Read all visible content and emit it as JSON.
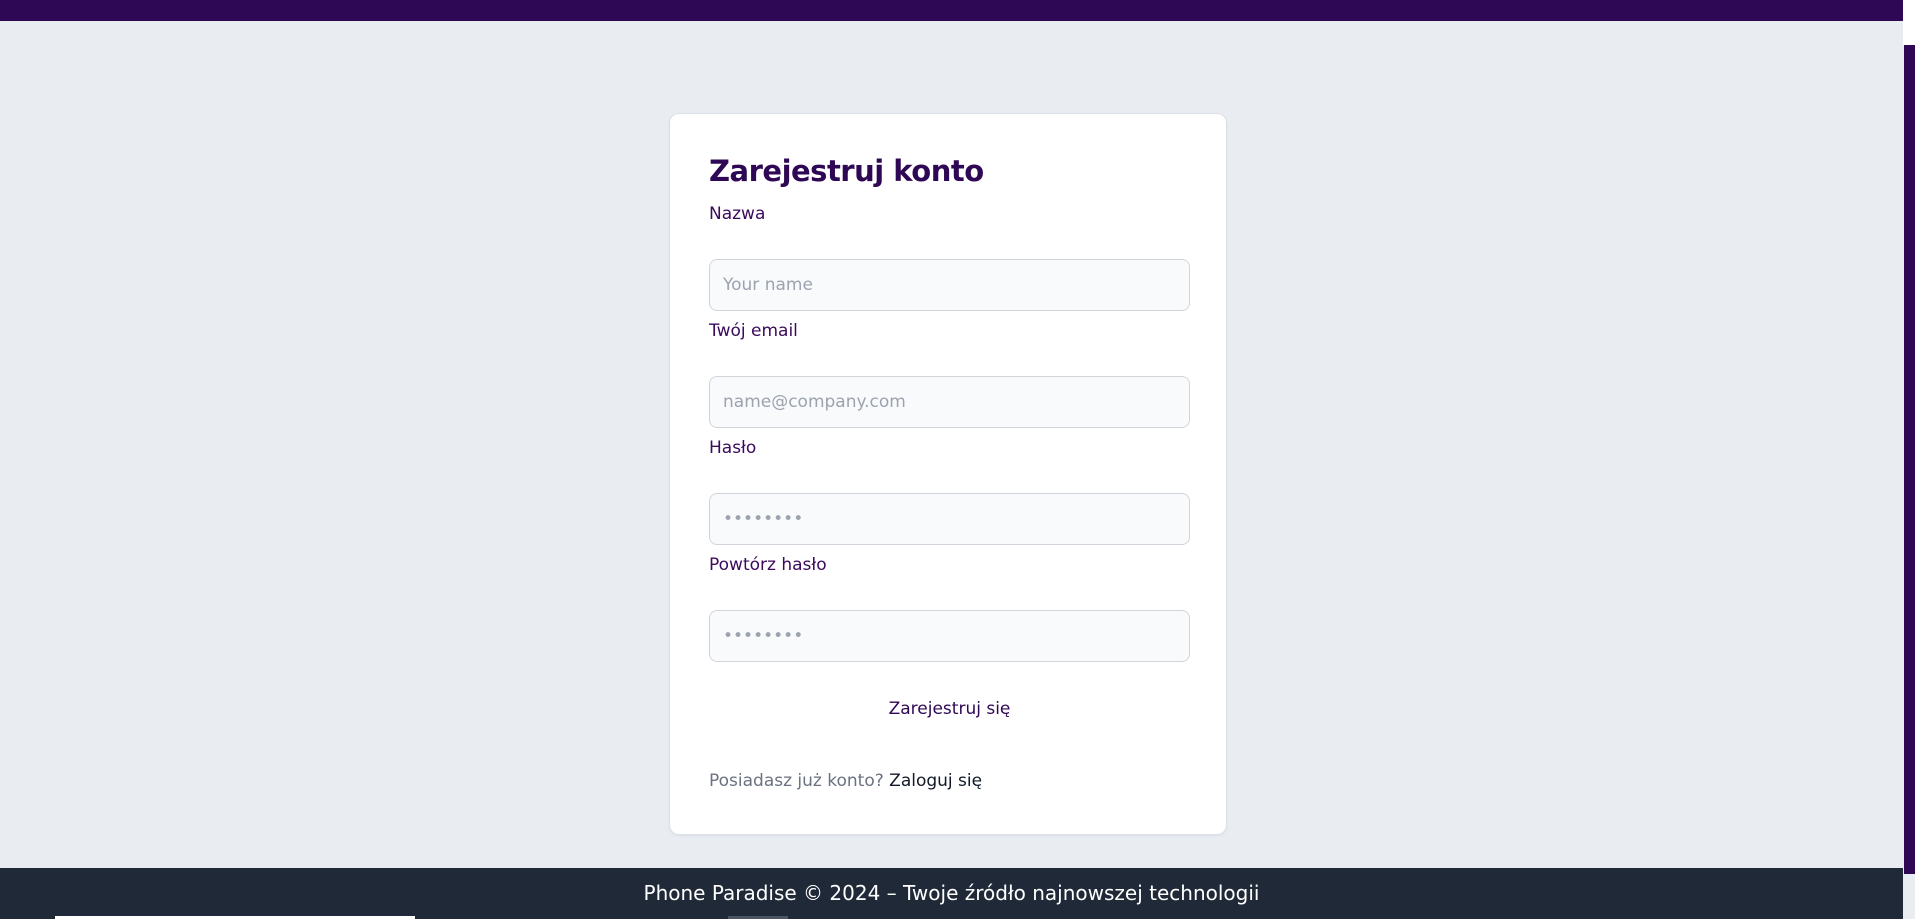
{
  "form": {
    "title": "Zarejestruj konto",
    "name_label": "Nazwa",
    "name_placeholder": "Your name",
    "email_label": "Twój email",
    "email_placeholder": "name@company.com",
    "password_label": "Hasło",
    "password_placeholder": "••••••••",
    "repeat_password_label": "Powtórz hasło",
    "repeat_password_placeholder": "••••••••",
    "submit_label": "Zarejestruj się",
    "login_prompt": "Posiadasz już konto?",
    "login_link": "Zaloguj się"
  },
  "footer": {
    "text": "Phone Paradise © 2024 – Twoje źródło najnowszej technologii"
  },
  "colors": {
    "brand": "#2e0854",
    "background": "#e9edf2",
    "footer": "#1f2937"
  }
}
